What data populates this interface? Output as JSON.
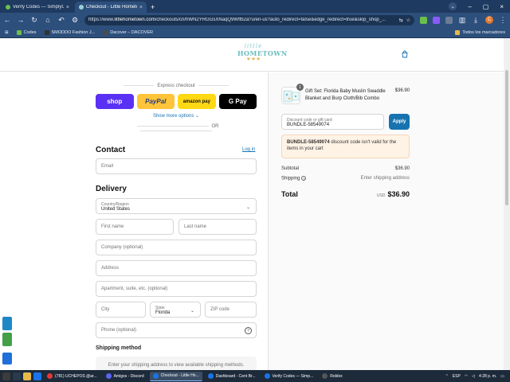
{
  "browser": {
    "tabs": [
      {
        "label": "Verify Codes — SimplyCodes",
        "fav_color": "#6bc04b",
        "active": false
      },
      {
        "label": "Checkout - Little Hometown",
        "fav_color": "#9ad0d3",
        "active": true
      }
    ],
    "url_prefix": "https://www.",
    "url_domain": "littlehometown.com",
    "url_rest": "/checkouts/cn/hWN2YRGGsXNaqQ9Wffb2a?u/en-us?auto_redirect=false&edge_redirect=true&skip_shop_...",
    "bookmarks": [
      {
        "label": "Codes",
        "color": "#6bc04b"
      },
      {
        "label": "SMODDO Fashion J...",
        "color": "#333333"
      },
      {
        "label": "Dacover – DACOVER",
        "color": "#4a4a4a"
      }
    ],
    "bookmarks_right": "Todos los marcadores",
    "profile_initial": "C"
  },
  "header": {
    "logo_line1": "little",
    "logo_line2": "HOMETOWN",
    "logo_hearts": "♥ ♥ ♥"
  },
  "express": {
    "title": "Express checkout",
    "buttons": {
      "shop": "shop",
      "paypal": "PayPal",
      "amazon": "amazon pay",
      "gpay": "G Pay"
    },
    "more_options": "Show more options ⌄",
    "or": "OR"
  },
  "contact": {
    "heading": "Contact",
    "login": "Log in",
    "email_placeholder": "Email"
  },
  "delivery": {
    "heading": "Delivery",
    "country_label": "Country/Region",
    "country_value": "United States",
    "first_name": "First name",
    "last_name": "Last name",
    "company": "Company (optional)",
    "address": "Address",
    "apartment": "Apartment, suite, etc. (optional)",
    "city": "City",
    "state_label": "State",
    "state_value": "Florida",
    "zip": "ZIP code",
    "phone": "Phone (optional)"
  },
  "shipping": {
    "heading": "Shipping method",
    "message": "Enter your shipping address to view available shipping methods."
  },
  "order": {
    "qty": "1",
    "product_name": "Gift Set: Florida Baby Muslin Swaddle Blanket and Burp Cloth/Bib Combo",
    "product_price": "$36.90",
    "discount_label": "Discount code or gift card",
    "discount_value": "BUNDLE-58549074",
    "apply": "Apply",
    "error_code": "BUNDLE-58549074",
    "error_message": " discount code isn't valid for the items in your cart",
    "subtotal_label": "Subtotal",
    "subtotal_value": "$36.90",
    "shipping_label": "Shipping",
    "shipping_value": "Enter shipping address",
    "total_label": "Total",
    "total_currency": "USD",
    "total_value": "$36.90"
  },
  "taskbar": {
    "items": [
      {
        "label": "(781) UCHEPOS @ar...",
        "color": "#e53935"
      },
      {
        "label": "Amigos - Discord",
        "color": "#5865f2"
      },
      {
        "label": "Checkout - Little Ho...",
        "color": "#1a73e8",
        "active": true
      },
      {
        "label": "Dashboard - Cent Br...",
        "color": "#1a73e8"
      },
      {
        "label": "Verify Codes — Simp...",
        "color": "#1a73e8"
      },
      {
        "label": "Roblox",
        "color": "#555555"
      }
    ],
    "lang": "ESP",
    "time": "4:28 p. m."
  }
}
